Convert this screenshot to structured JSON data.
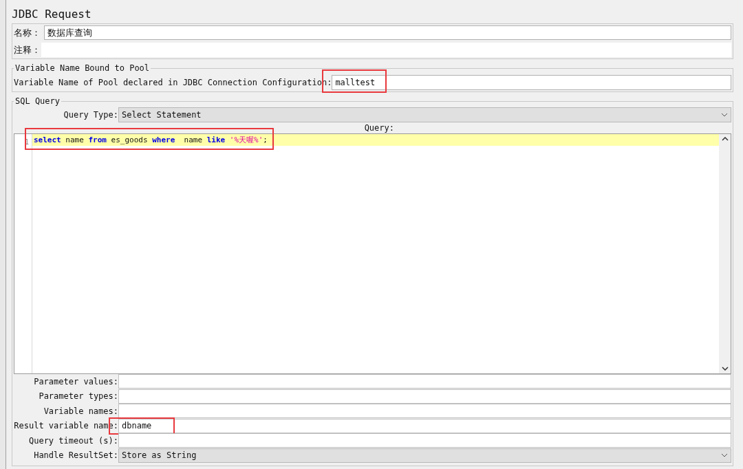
{
  "title": "JDBC Request",
  "name_field": {
    "label": "名称：",
    "value": "数据库查询"
  },
  "comment_field": {
    "label": "注释："
  },
  "pool": {
    "legend": "Variable Name Bound to Pool",
    "label": "Variable Name of Pool declared in JDBC Connection Configuration:",
    "value": "malltest",
    "highlighted": true
  },
  "sql": {
    "legend": "SQL Query",
    "query_type": {
      "label": "Query Type:",
      "value": "Select Statement"
    },
    "query_label": "Query:",
    "editor": {
      "line_number": "1",
      "highlighted": true,
      "tokens": [
        {
          "kind": "keyword",
          "text": "select"
        },
        {
          "kind": "plain",
          "text": " name "
        },
        {
          "kind": "keyword",
          "text": "from"
        },
        {
          "kind": "plain",
          "text": " es_goods "
        },
        {
          "kind": "keyword",
          "text": "where"
        },
        {
          "kind": "plain",
          "text": "  name "
        },
        {
          "kind": "keyword",
          "text": "like"
        },
        {
          "kind": "string",
          "text": " '%天喔%'"
        },
        {
          "kind": "plain",
          "text": ";"
        }
      ]
    },
    "fields": [
      {
        "kind": "text",
        "label": "Parameter values:",
        "highlighted": false
      },
      {
        "kind": "text",
        "label": "Parameter types:",
        "highlighted": false
      },
      {
        "kind": "text",
        "label": "Variable names:",
        "highlighted": false
      },
      {
        "kind": "text",
        "label": "Result variable name:",
        "value": "dbname",
        "highlighted": true
      },
      {
        "kind": "text",
        "label": "Query timeout (s):",
        "highlighted": false
      },
      {
        "kind": "select",
        "label": "Handle ResultSet:",
        "value": "Store as String",
        "highlighted": false
      }
    ]
  }
}
